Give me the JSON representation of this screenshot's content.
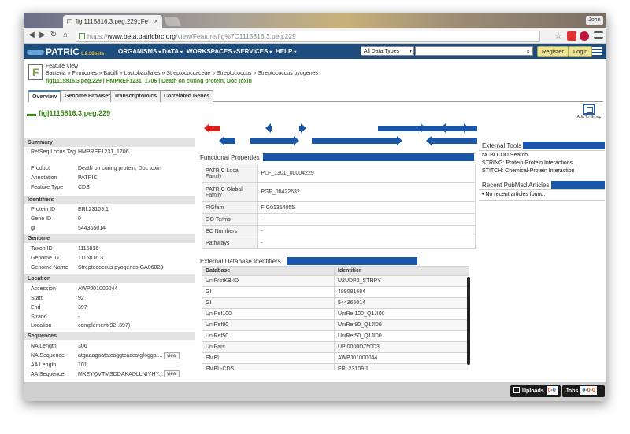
{
  "browser": {
    "tab_title": "fig|1115816.3.peg.229::Fe",
    "user_label": "John",
    "url_prefix": "https://",
    "url_host": "www.beta.patricbrc.org",
    "url_path": "/view/Feature/fig%7C1115816.3.peg.229"
  },
  "header": {
    "logo": "PATRIC",
    "version": "3.2.38beta",
    "menus": [
      "ORGANISMS",
      "DATA",
      "WORKSPACES",
      "SERVICES",
      "HELP"
    ],
    "data_type_select": "All Data Types",
    "register_label": "Register",
    "login_label": "Login"
  },
  "feature": {
    "view_label": "Feature View",
    "breadcrumb": "Bacteria » Firmicutes » Bacilli » Lactobacillales » Streptococcaceae » Streptococcus » Streptococcus pyogenes",
    "id_line": "fig|1115816.3.peg.229 | HMPREF1231_1706 | Death on curing protein, Doc toxin",
    "title": "fig|1115816.3.peg.229"
  },
  "tabs": [
    "Overview",
    "Genome Browser",
    "Transcriptomics",
    "Correlated Genes"
  ],
  "summary": {
    "heading": "Summary",
    "rows": [
      {
        "k": "RefSeq Locus Tag",
        "v": "HMPREF1231_1706"
      },
      {
        "k": "Product",
        "v": "Death on curing protein, Doc toxin"
      },
      {
        "k": "Annotation",
        "v": "PATRIC"
      },
      {
        "k": "Feature Type",
        "v": "CDS"
      }
    ]
  },
  "identifiers": {
    "heading": "Identifiers",
    "rows": [
      {
        "k": "Protein ID",
        "v": "ERL23109.1"
      },
      {
        "k": "Gene ID",
        "v": "0"
      },
      {
        "k": "gi",
        "v": "544365014"
      }
    ]
  },
  "genome": {
    "heading": "Genome",
    "rows": [
      {
        "k": "Taxon ID",
        "v": "1115816"
      },
      {
        "k": "Genome ID",
        "v": "1115816.3"
      },
      {
        "k": "Genome Name",
        "v": "Streptococcus pyogenes GA06023"
      }
    ]
  },
  "location": {
    "heading": "Location",
    "rows": [
      {
        "k": "Accession",
        "v": "AWPJ01000044"
      },
      {
        "k": "Start",
        "v": "92"
      },
      {
        "k": "End",
        "v": "397"
      },
      {
        "k": "Strand",
        "v": "-"
      },
      {
        "k": "Location",
        "v": "complement(92..397)"
      }
    ]
  },
  "sequences": {
    "heading": "Sequences",
    "rows": [
      {
        "k": "NA Length",
        "v": "306"
      },
      {
        "k": "NA Sequence",
        "v": "atgaaagaatatcaggtcaccatgfoggat..."
      },
      {
        "k": "AA Length",
        "v": "101"
      },
      {
        "k": "AA Sequence",
        "v": "MKEYQVTMSDDAKADLLNIYHY..."
      }
    ],
    "view_label": "view"
  },
  "functional": {
    "title": "Functional Properties",
    "rows": [
      {
        "k": "PATRIC Local Family",
        "v": "PLF_1301_00004229"
      },
      {
        "k": "PATRIC Global Family",
        "v": "PGF_00422632"
      },
      {
        "k": "FIGfam",
        "v": "FIG01354055"
      },
      {
        "k": "GO Terms",
        "v": "-"
      },
      {
        "k": "EC Numbers",
        "v": "-"
      },
      {
        "k": "Pathways",
        "v": "-"
      }
    ]
  },
  "external_db": {
    "title": "External Database Identifiers",
    "col_db": "Database",
    "col_id": "Identifier",
    "rows": [
      {
        "db": "UniProtKB-ID",
        "id": "U2UDP2_STRPY"
      },
      {
        "db": "GI",
        "id": "489081684"
      },
      {
        "db": "GI",
        "id": "544365014"
      },
      {
        "db": "UniRef100",
        "id": "UniRef100_Q1JI00"
      },
      {
        "db": "UniRef90",
        "id": "UniRef90_Q1JI00"
      },
      {
        "db": "UniRef50",
        "id": "UniRef50_Q1JI00"
      },
      {
        "db": "UniParc",
        "id": "UPI0000D750D3"
      },
      {
        "db": "EMBL",
        "id": "AWPJ01000044"
      },
      {
        "db": "EMBL-CDS",
        "id": "ERL23109.1"
      }
    ]
  },
  "right": {
    "add_to_group": "Add To Group",
    "tools_title": "External Tools",
    "tools": [
      "NCBI CDD Search",
      "STRING: Protein-Protein Interactions",
      "STITCH: Chemical-Protein Interaction"
    ],
    "pubmed_title": "Recent PubMed Articles",
    "pubmed_empty": "• No recent articles found."
  },
  "footer": {
    "uploads_label": "Uploads",
    "uploads_count_a": "0",
    "uploads_count_b": "0",
    "jobs_label": "Jobs",
    "jobs_count_a": "0",
    "jobs_count_b": "0",
    "jobs_count_c": "0"
  },
  "colors": {
    "nav_bg": "#1e4c7d",
    "accent_green": "#3b8a16",
    "arrow_red": "#d81e1e",
    "arrow_blue": "#1a56a8"
  }
}
